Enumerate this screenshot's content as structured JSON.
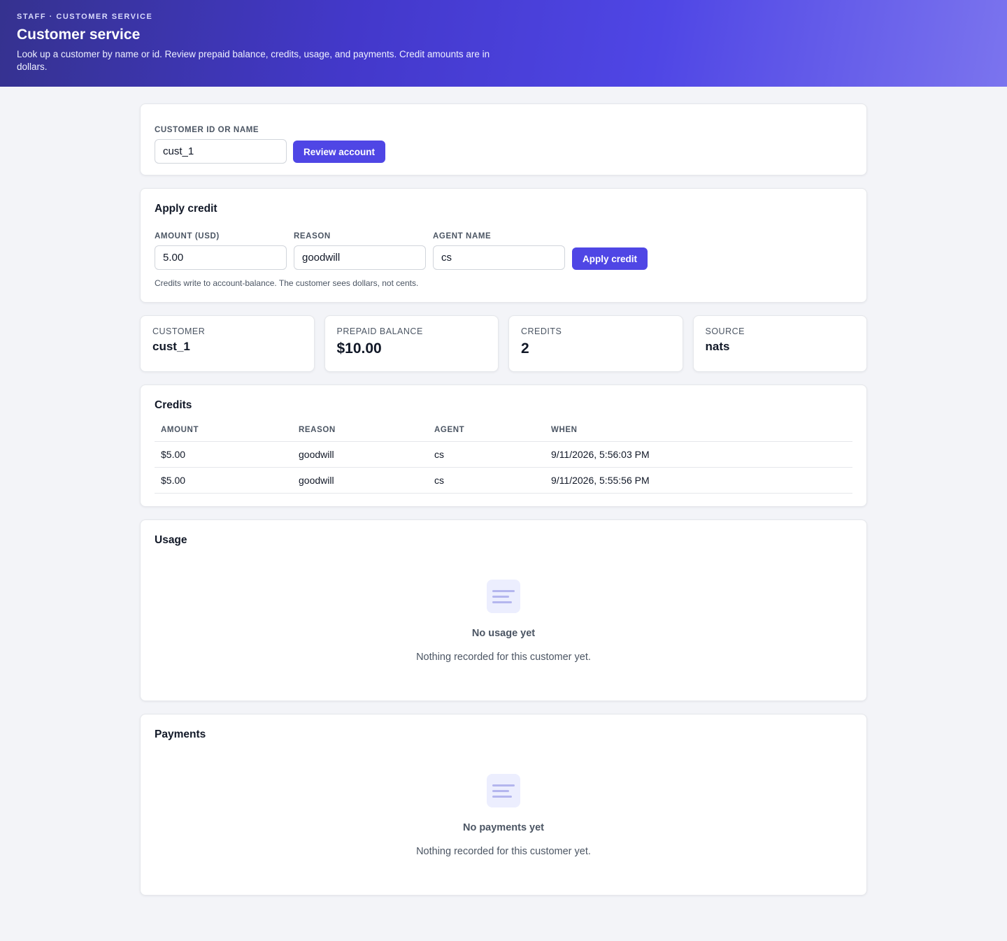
{
  "header": {
    "eyebrow": "STAFF · CUSTOMER SERVICE",
    "title": "Customer service",
    "description": "Look up a customer by name or id. Review prepaid balance, credits, usage, and payments. Credit amounts are in dollars."
  },
  "lookup": {
    "label": "CUSTOMER ID OR NAME",
    "value": "cust_1",
    "button": "Review account"
  },
  "apply_credit": {
    "title": "Apply credit",
    "amount_label": "AMOUNT (USD)",
    "amount_value": "5.00",
    "reason_label": "REASON",
    "reason_value": "goodwill",
    "agent_label": "AGENT NAME",
    "agent_value": "cs",
    "button": "Apply credit",
    "hint": "Credits write to account-balance. The customer sees dollars, not cents."
  },
  "stats": [
    {
      "label": "CUSTOMER",
      "value": "cust_1"
    },
    {
      "label": "PREPAID BALANCE",
      "value": "$10.00"
    },
    {
      "label": "CREDITS",
      "value": "2"
    },
    {
      "label": "SOURCE",
      "value": "nats"
    }
  ],
  "credits": {
    "title": "Credits",
    "columns": [
      "AMOUNT",
      "REASON",
      "AGENT",
      "WHEN"
    ],
    "rows": [
      {
        "amount": "$5.00",
        "reason": "goodwill",
        "agent": "cs",
        "when": "9/11/2026, 5:56:03 PM"
      },
      {
        "amount": "$5.00",
        "reason": "goodwill",
        "agent": "cs",
        "when": "9/11/2026, 5:55:56 PM"
      }
    ]
  },
  "usage": {
    "title": "Usage",
    "empty_title": "No usage yet",
    "empty_text": "Nothing recorded for this customer yet.",
    "icon": "list-icon"
  },
  "payments": {
    "title": "Payments",
    "empty_title": "No payments yet",
    "empty_text": "Nothing recorded for this customer yet.",
    "icon": "list-icon"
  },
  "colors": {
    "accent": "#4f46e5",
    "hero_start": "#35328f",
    "hero_end": "#7b74ee",
    "background": "#f3f4f8"
  }
}
